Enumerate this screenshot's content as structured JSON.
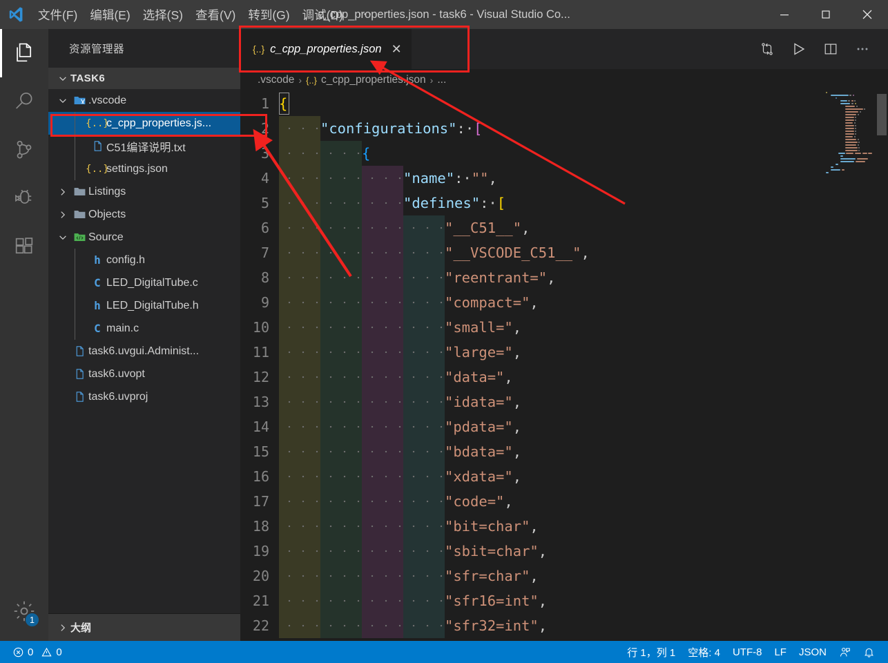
{
  "window": {
    "title": "c_cpp_properties.json - task6 - Visual Studio Co...",
    "minimize": "—",
    "maximize": "□",
    "close": "✕"
  },
  "menu": {
    "items": [
      {
        "label": "文件(F)",
        "name": "menu-file"
      },
      {
        "label": "编辑(E)",
        "name": "menu-edit"
      },
      {
        "label": "选择(S)",
        "name": "menu-selection"
      },
      {
        "label": "查看(V)",
        "name": "menu-view"
      },
      {
        "label": "转到(G)",
        "name": "menu-go"
      },
      {
        "label": "调试(D)",
        "name": "menu-debug"
      }
    ],
    "overflow": "···"
  },
  "activitybar": {
    "items": [
      {
        "name": "explorer-icon",
        "label": "资源管理器",
        "active": true
      },
      {
        "name": "search-icon",
        "label": "搜索",
        "active": false
      },
      {
        "name": "source-control-icon",
        "label": "源代码管理",
        "active": false
      },
      {
        "name": "debug-icon",
        "label": "调试",
        "active": false
      },
      {
        "name": "extensions-icon",
        "label": "扩展",
        "active": false
      }
    ],
    "settings": {
      "name": "settings-gear-icon",
      "badge": "1"
    }
  },
  "sidebar": {
    "title": "资源管理器",
    "root_label": "TASK6",
    "outline_label": "大纲",
    "tree": [
      {
        "label": ".vscode",
        "icon": "vscode-folder",
        "depth": 1,
        "twisty": "down",
        "selected": false
      },
      {
        "label": "c_cpp_properties.js...",
        "icon": "json",
        "depth": 2,
        "twisty": "",
        "selected": true
      },
      {
        "label": "C51编译说明.txt",
        "icon": "text",
        "depth": 2,
        "twisty": "",
        "selected": false
      },
      {
        "label": "settings.json",
        "icon": "json",
        "depth": 2,
        "twisty": "",
        "selected": false
      },
      {
        "label": "Listings",
        "icon": "folder",
        "depth": 1,
        "twisty": "right",
        "selected": false
      },
      {
        "label": "Objects",
        "icon": "folder",
        "depth": 1,
        "twisty": "right",
        "selected": false
      },
      {
        "label": "Source",
        "icon": "src-folder",
        "depth": 1,
        "twisty": "down",
        "selected": false
      },
      {
        "label": "config.h",
        "icon": "h",
        "depth": 2,
        "twisty": "",
        "selected": false
      },
      {
        "label": "LED_DigitalTube.c",
        "icon": "c",
        "depth": 2,
        "twisty": "",
        "selected": false
      },
      {
        "label": "LED_DigitalTube.h",
        "icon": "h",
        "depth": 2,
        "twisty": "",
        "selected": false
      },
      {
        "label": "main.c",
        "icon": "c",
        "depth": 2,
        "twisty": "",
        "selected": false
      },
      {
        "label": "task6.uvgui.Administ...",
        "icon": "text",
        "depth": 1,
        "twisty": "",
        "selected": false
      },
      {
        "label": "task6.uvopt",
        "icon": "text",
        "depth": 1,
        "twisty": "",
        "selected": false
      },
      {
        "label": "task6.uvproj",
        "icon": "text",
        "depth": 1,
        "twisty": "",
        "selected": false
      }
    ]
  },
  "editor": {
    "tab": {
      "label": "c_cpp_properties.json",
      "icon": "json-icon",
      "close": "✕",
      "preview": true
    },
    "actions": [
      {
        "name": "compare-changes-icon"
      },
      {
        "name": "run-icon"
      },
      {
        "name": "split-editor-icon"
      },
      {
        "name": "more-actions-icon",
        "label": "···"
      }
    ],
    "breadcrumb": {
      "folder": ".vscode",
      "file": "c_cpp_properties.json",
      "more": "...",
      "separator": "›"
    },
    "cursor": {
      "line": 1,
      "column": 1
    },
    "lines": [
      {
        "n": 1,
        "indent": 0,
        "tokens": [
          {
            "t": "{",
            "c": "brace"
          }
        ]
      },
      {
        "n": 2,
        "indent": 1,
        "tokens": [
          {
            "t": "\"configurations\"",
            "c": "key"
          },
          {
            "t": ":·",
            "c": "pun"
          },
          {
            "t": "[",
            "c": "brace2"
          }
        ]
      },
      {
        "n": 3,
        "indent": 2,
        "tokens": [
          {
            "t": "{",
            "c": "brace3"
          }
        ]
      },
      {
        "n": 4,
        "indent": 3,
        "tokens": [
          {
            "t": "\"name\"",
            "c": "key"
          },
          {
            "t": ":·",
            "c": "pun"
          },
          {
            "t": "\"\"",
            "c": "str"
          },
          {
            "t": ",",
            "c": "pun"
          }
        ]
      },
      {
        "n": 5,
        "indent": 3,
        "tokens": [
          {
            "t": "\"defines\"",
            "c": "key"
          },
          {
            "t": ":·",
            "c": "pun"
          },
          {
            "t": "[",
            "c": "brace"
          }
        ]
      },
      {
        "n": 6,
        "indent": 4,
        "tokens": [
          {
            "t": "\"__C51__\"",
            "c": "str"
          },
          {
            "t": ",",
            "c": "pun"
          }
        ]
      },
      {
        "n": 7,
        "indent": 4,
        "tokens": [
          {
            "t": "\"__VSCODE_C51__\"",
            "c": "str"
          },
          {
            "t": ",",
            "c": "pun"
          }
        ]
      },
      {
        "n": 8,
        "indent": 4,
        "tokens": [
          {
            "t": "\"reentrant=\"",
            "c": "str"
          },
          {
            "t": ",",
            "c": "pun"
          }
        ]
      },
      {
        "n": 9,
        "indent": 4,
        "tokens": [
          {
            "t": "\"compact=\"",
            "c": "str"
          },
          {
            "t": ",",
            "c": "pun"
          }
        ]
      },
      {
        "n": 10,
        "indent": 4,
        "tokens": [
          {
            "t": "\"small=\"",
            "c": "str"
          },
          {
            "t": ",",
            "c": "pun"
          }
        ]
      },
      {
        "n": 11,
        "indent": 4,
        "tokens": [
          {
            "t": "\"large=\"",
            "c": "str"
          },
          {
            "t": ",",
            "c": "pun"
          }
        ]
      },
      {
        "n": 12,
        "indent": 4,
        "tokens": [
          {
            "t": "\"data=\"",
            "c": "str"
          },
          {
            "t": ",",
            "c": "pun"
          }
        ]
      },
      {
        "n": 13,
        "indent": 4,
        "tokens": [
          {
            "t": "\"idata=\"",
            "c": "str"
          },
          {
            "t": ",",
            "c": "pun"
          }
        ]
      },
      {
        "n": 14,
        "indent": 4,
        "tokens": [
          {
            "t": "\"pdata=\"",
            "c": "str"
          },
          {
            "t": ",",
            "c": "pun"
          }
        ]
      },
      {
        "n": 15,
        "indent": 4,
        "tokens": [
          {
            "t": "\"bdata=\"",
            "c": "str"
          },
          {
            "t": ",",
            "c": "pun"
          }
        ]
      },
      {
        "n": 16,
        "indent": 4,
        "tokens": [
          {
            "t": "\"xdata=\"",
            "c": "str"
          },
          {
            "t": ",",
            "c": "pun"
          }
        ]
      },
      {
        "n": 17,
        "indent": 4,
        "tokens": [
          {
            "t": "\"code=\"",
            "c": "str"
          },
          {
            "t": ",",
            "c": "pun"
          }
        ]
      },
      {
        "n": 18,
        "indent": 4,
        "tokens": [
          {
            "t": "\"bit=char\"",
            "c": "str"
          },
          {
            "t": ",",
            "c": "pun"
          }
        ]
      },
      {
        "n": 19,
        "indent": 4,
        "tokens": [
          {
            "t": "\"sbit=char\"",
            "c": "str"
          },
          {
            "t": ",",
            "c": "pun"
          }
        ]
      },
      {
        "n": 20,
        "indent": 4,
        "tokens": [
          {
            "t": "\"sfr=char\"",
            "c": "str"
          },
          {
            "t": ",",
            "c": "pun"
          }
        ]
      },
      {
        "n": 21,
        "indent": 4,
        "tokens": [
          {
            "t": "\"sfr16=int\"",
            "c": "str"
          },
          {
            "t": ",",
            "c": "pun"
          }
        ]
      },
      {
        "n": 22,
        "indent": 4,
        "tokens": [
          {
            "t": "\"sfr32=int\"",
            "c": "str"
          },
          {
            "t": ",",
            "c": "pun"
          }
        ]
      }
    ]
  },
  "statusbar": {
    "errors": "0",
    "warnings": "0",
    "position": "行 1，列 1",
    "spaces": "空格: 4",
    "encoding": "UTF-8",
    "eol": "LF",
    "language": "JSON",
    "feedback_icon": "feedback-icon",
    "bell_icon": "bell-icon"
  },
  "annotations": {
    "highlight_tab": true,
    "highlight_sidebar_file": true,
    "arrow_color": "#f0221f"
  }
}
